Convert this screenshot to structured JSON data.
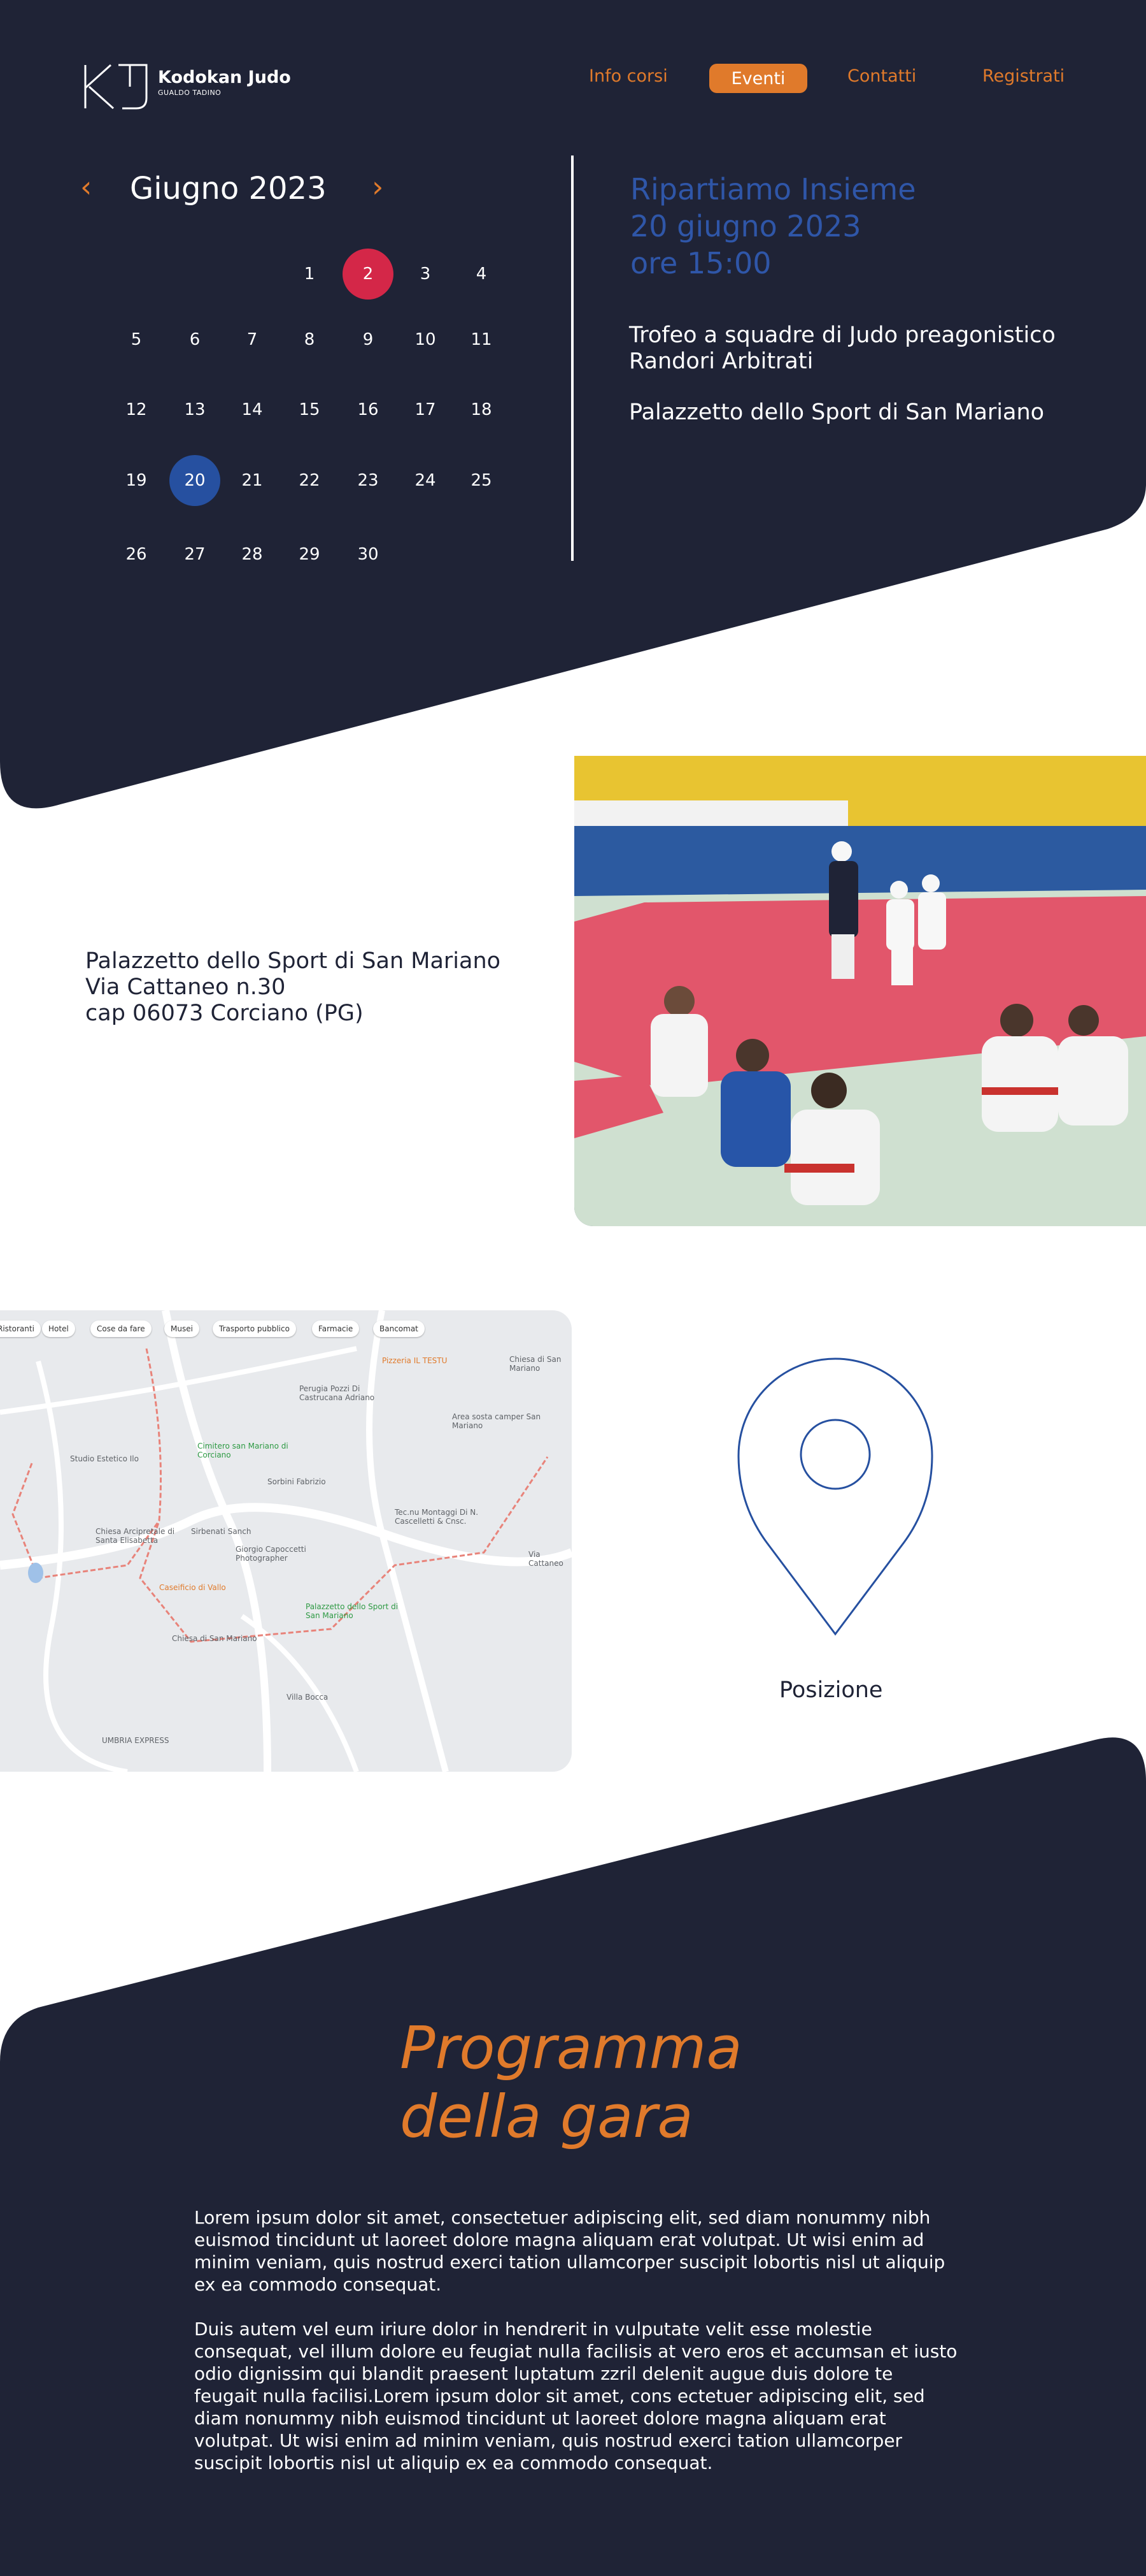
{
  "header": {
    "logo_text": "Kodokan Judo",
    "logo_subtitle": "GUALDO TADINO",
    "nav": [
      "Info corsi",
      "Eventi",
      "Contatti",
      "Registrati"
    ],
    "active_nav": "Eventi"
  },
  "calendar": {
    "month_label": "Giugno 2023",
    "prev_icon": "chevron-left-icon",
    "next_icon": "chevron-right-icon",
    "weeks": [
      [
        "",
        "",
        "",
        "1",
        "2",
        "3",
        "4"
      ],
      [
        "5",
        "6",
        "7",
        "8",
        "9",
        "10",
        "11"
      ],
      [
        "12",
        "13",
        "14",
        "15",
        "16",
        "17",
        "18"
      ],
      [
        "19",
        "20",
        "21",
        "22",
        "23",
        "24",
        "25"
      ],
      [
        "26",
        "27",
        "28",
        "29",
        "30",
        "",
        ""
      ]
    ],
    "highlight_red": "2",
    "highlight_blue": "20"
  },
  "event": {
    "headline": [
      "Ripartiamo Insieme",
      "20 giugno 2023",
      "ore 15:00"
    ],
    "description_line1": "Trofeo a squadre di Judo preagonistico",
    "description_line2": "Randori Arbitrati",
    "place": "Palazzetto dello Sport di San Mariano"
  },
  "venue": {
    "name": "Palazzetto dello Sport di San Mariano",
    "street": "Via Cattaneo n.30",
    "city": "cap 06073 Corciano (PG)"
  },
  "map": {
    "chips": [
      "Ristoranti",
      "Hotel",
      "Cose da fare",
      "Musei",
      "Trasporto pubblico",
      "Farmacie",
      "Bancomat"
    ],
    "labels": [
      "Pizzeria IL TESTU",
      "Chiesa di San Mariano",
      "Perugia Pozzi Di Castrucana Adriano",
      "Area sosta camper San Mariano",
      "Studio Estetico Ilo",
      "Cimitero san Mariano di Corciano",
      "Sorbini Fabrizio",
      "Tec.nu Montaggi Di N. Cascelletti & Cnsc.",
      "Chiesa Arcipretale di Santa Elisabetta",
      "Sirbenati Sanch",
      "Giorgio Capoccetti Photographer",
      "Caseificio di Vallo",
      "Palazzetto dello Sport di San Mariano",
      "Chiesa di San Mariano",
      "Villa Bocca",
      "UMBRIA EXPRESS",
      "Via Cattaneo"
    ]
  },
  "position": {
    "label": "Posizione",
    "icon": "location-pin-icon"
  },
  "program": {
    "title_line1": "Programma",
    "title_line2": "della gara",
    "paragraph1": "Lorem ipsum dolor sit amet, consectetuer adipiscing elit, sed diam nonummy nibh euismod tincidunt ut laoreet dolore magna aliquam erat volutpat. Ut wisi enim ad minim veniam, quis nostrud exerci tation ullamcorper suscipit lobortis nisl ut aliquip ex ea commodo consequat.",
    "paragraph2": "Duis autem vel eum iriure dolor in hendrerit in vulputate velit esse molestie consequat, vel illum dolore eu feugiat nulla facilisis at vero eros et accumsan et iusto odio dignissim qui blandit praesent luptatum zzril delenit augue duis dolore te feugait nulla facilisi.Lorem ipsum dolor sit amet, cons ectetuer adipiscing elit, sed diam nonummy nibh euismod tincidunt ut laoreet dolore magna aliquam erat volutpat. Ut wisi enim ad minim veniam, quis nostrud exerci tation ullamcorper suscipit lobortis nisl ut aliquip ex ea commodo consequat."
  },
  "colors": {
    "navy": "#1f2336",
    "orange": "#e07a2b",
    "blue": "#2650a0",
    "red": "#d42748"
  }
}
